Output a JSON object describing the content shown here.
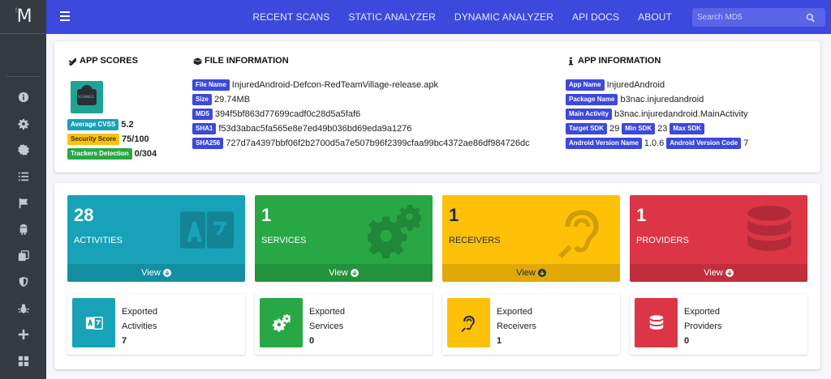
{
  "brand": {
    "logo_text": "M"
  },
  "topbar": {
    "nav": [
      "RECENT SCANS",
      "STATIC ANALYZER",
      "DYNAMIC ANALYZER",
      "API DOCS",
      "ABOUT"
    ],
    "search_placeholder": "Search MD5"
  },
  "sidebar": {
    "items": [
      "info-icon",
      "gear-icon",
      "cog-badge-icon",
      "list-icon",
      "flag-icon",
      "android-icon",
      "copy-icon",
      "shield-icon",
      "bug-icon",
      "plus-icon",
      "grid-icon"
    ]
  },
  "app_scores": {
    "title": "APP SCORES",
    "average_cvss_label": "Average CVSS",
    "average_cvss": "5.2",
    "security_score_label": "Security Score",
    "security_score": "75/100",
    "trackers_label": "Trackers Detection",
    "trackers": "0/304"
  },
  "file_info": {
    "title": "FILE INFORMATION",
    "rows": [
      {
        "label": "File Name",
        "value": "InjuredAndroid-Defcon-RedTeamVillage-release.apk"
      },
      {
        "label": "Size",
        "value": "29.74MB"
      },
      {
        "label": "MD5",
        "value": "394f5bf863d77699cadf0c28d5a5faf6"
      },
      {
        "label": "SHA1",
        "value": "f53d3abac5fa565e8e7ed49b036bd69eda9a1276"
      },
      {
        "label": "SHA256",
        "value": "727d7a4397bbf06f2b2700d5a7e507b96f2399cfaa99bc4372ae86df984726dc"
      }
    ]
  },
  "app_info": {
    "title": "APP INFORMATION",
    "app_name_label": "App Name",
    "app_name": "InjuredAndroid",
    "package_label": "Package Name",
    "package": "b3nac.injuredandroid",
    "main_activity_label": "Main Activity",
    "main_activity": "b3nac.injuredandroid.MainActivity",
    "target_sdk_label": "Target SDK",
    "target_sdk": "29",
    "min_sdk_label": "Min SDK",
    "min_sdk": "23",
    "max_sdk_label": "Max SDK",
    "version_name_label": "Android Version Name",
    "version_name": "1.0.6",
    "version_code_label": "Android Version Code",
    "version_code": "7"
  },
  "tiles": [
    {
      "count": "28",
      "label": "ACTIVITIES",
      "view": "View",
      "color": "#17a2b8"
    },
    {
      "count": "1",
      "label": "SERVICES",
      "view": "View",
      "color": "#28a745"
    },
    {
      "count": "1",
      "label": "RECEIVERS",
      "view": "View",
      "color": "#ffc107"
    },
    {
      "count": "1",
      "label": "PROVIDERS",
      "view": "View",
      "color": "#dc3545"
    }
  ],
  "exported": [
    {
      "line1": "Exported",
      "line2": "Activities",
      "count": "7"
    },
    {
      "line1": "Exported",
      "line2": "Services",
      "count": "0"
    },
    {
      "line1": "Exported",
      "line2": "Receivers",
      "count": "1"
    },
    {
      "line1": "Exported",
      "line2": "Providers",
      "count": "0"
    }
  ]
}
